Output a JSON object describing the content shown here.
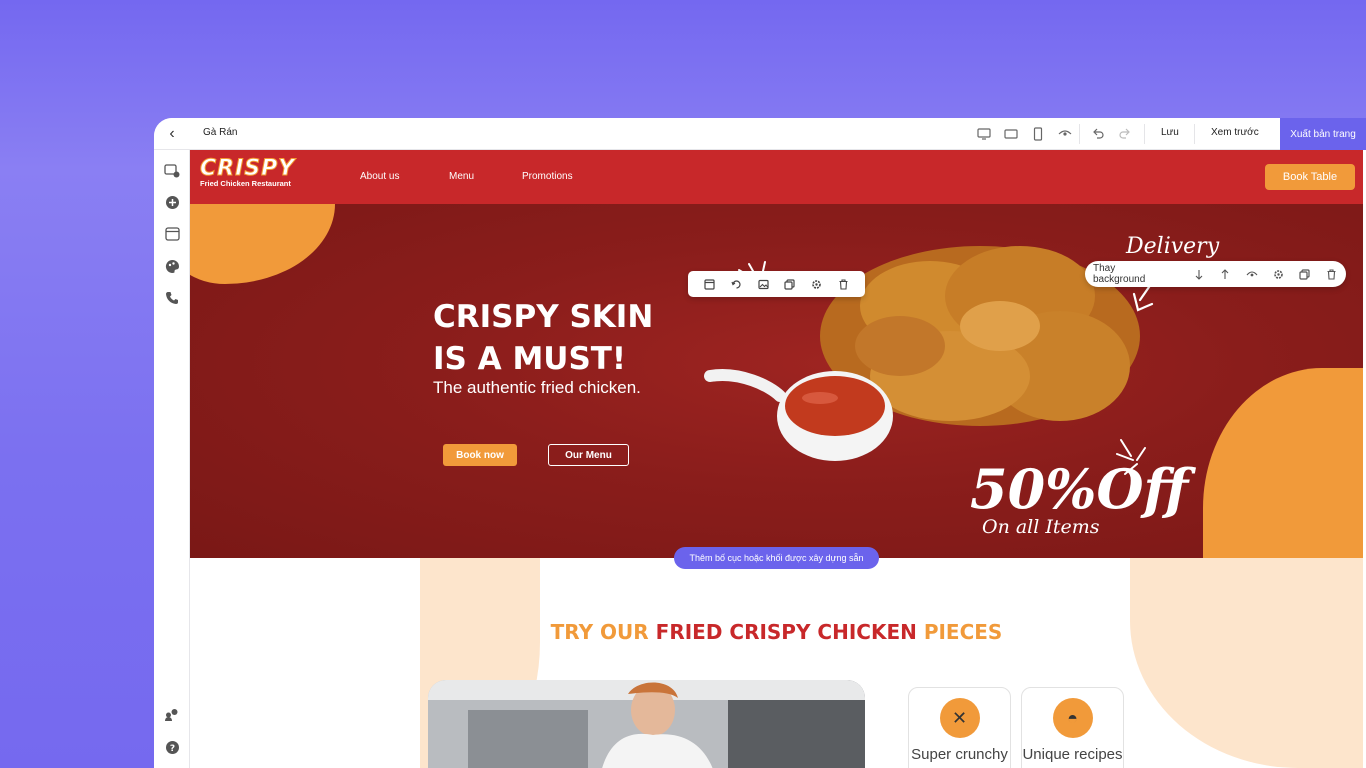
{
  "editor": {
    "page_name": "Gà Rán",
    "save_label": "Lưu",
    "preview_label": "Xem trước",
    "publish_label": "Xuất bản trang",
    "add_block_label": "Thêm bố cục hoặc khối được xây dựng sẵn",
    "section_toolbar_label": "Thay background",
    "accent_color": "#6b63ec"
  },
  "site": {
    "logo_text": "CRISPY",
    "logo_subtitle": "Fried Chicken Restaurant",
    "nav": [
      "About us",
      "Menu",
      "Promotions"
    ],
    "book_table_label": "Book Table",
    "brand_red": "#c8282a",
    "brand_orange": "#f19a3a"
  },
  "hero": {
    "title_line1": "CRISPY SKIN",
    "title_line2": "IS A MUST!",
    "subtitle": "The authentic fried chicken.",
    "book_now_label": "Book now",
    "our_menu_label": "Our Menu",
    "delivery_text": "Delivery",
    "promo_big": "50%Off",
    "promo_small": "On all Items"
  },
  "section": {
    "title_part1": "TRY OUR ",
    "title_part2": "FRIED CRISPY CHICKEN",
    "title_part3": " PIECES",
    "features": [
      "Super crunchy",
      "Unique recipes"
    ]
  }
}
